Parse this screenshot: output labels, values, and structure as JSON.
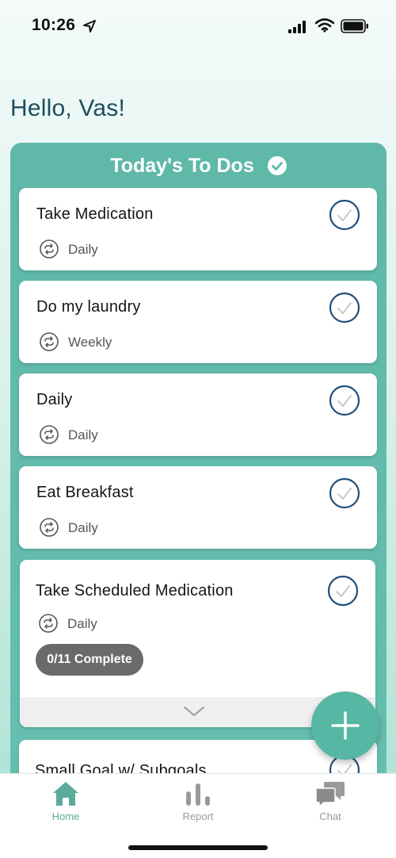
{
  "status": {
    "time": "10:26"
  },
  "greeting": "Hello, Vas!",
  "board": {
    "title": "Today's To Dos",
    "items": [
      {
        "title": "Take Medication",
        "frequency": "Daily"
      },
      {
        "title": "Do my laundry",
        "frequency": "Weekly"
      },
      {
        "title": "Daily",
        "frequency": "Daily"
      },
      {
        "title": "Eat Breakfast",
        "frequency": "Daily"
      },
      {
        "title": "Take Scheduled Medication",
        "frequency": "Daily",
        "progress": "0/11 Complete"
      },
      {
        "title": "Small Goal w/ Subgoals"
      }
    ]
  },
  "tabs": {
    "home": "Home",
    "report": "Report",
    "chat": "Chat"
  },
  "colors": {
    "accent": "#5fb8a8",
    "greeting": "#1d4e5e",
    "check_ring": "#1f4f7a"
  },
  "icons": {
    "fab": "plus-icon",
    "repeat": "repeat-icon",
    "check": "check-circle-icon"
  }
}
